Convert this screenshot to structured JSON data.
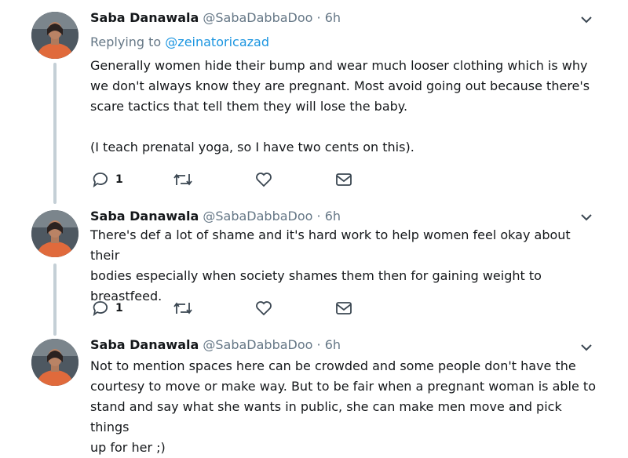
{
  "colors": {
    "text": "#14171a",
    "muted": "#657786",
    "link": "#1b95e0",
    "thread_line": "#c4cfd6",
    "icon": "#3b4752"
  },
  "tweets": [
    {
      "name": "Saba Danawala",
      "handle": "@SabaDabbaDoo",
      "separator": "·",
      "time": "6h",
      "replying_prefix": "Replying to",
      "replying_to": "@zeinatoricazad",
      "text": "Generally women hide their bump and wear much looser clothing which is why\nwe don't always know they are pregnant. Most avoid going out because there's\nscare tactics that tell them they will lose the baby.\n\n(I teach prenatal yoga, so I have two cents on this).",
      "reply_count": "1",
      "icons": [
        "reply-icon",
        "retweet-icon",
        "like-icon",
        "message-icon"
      ]
    },
    {
      "name": "Saba Danawala",
      "handle": "@SabaDabbaDoo",
      "separator": "·",
      "time": "6h",
      "text": "There's def a lot of shame and it's hard work to help women feel okay about their\nbodies especially when society shames them then for gaining weight to\nbreastfeed.",
      "reply_count": "1",
      "icons": [
        "reply-icon",
        "retweet-icon",
        "like-icon",
        "message-icon"
      ]
    },
    {
      "name": "Saba Danawala",
      "handle": "@SabaDabbaDoo",
      "separator": "·",
      "time": "6h",
      "text": "Not to mention spaces here can be crowded and some people don't have the\ncourtesy to move or make way. But to be fair when a pregnant woman is able to\nstand and say what she wants in public, she can make men move and pick things\nup for her ;)"
    }
  ]
}
